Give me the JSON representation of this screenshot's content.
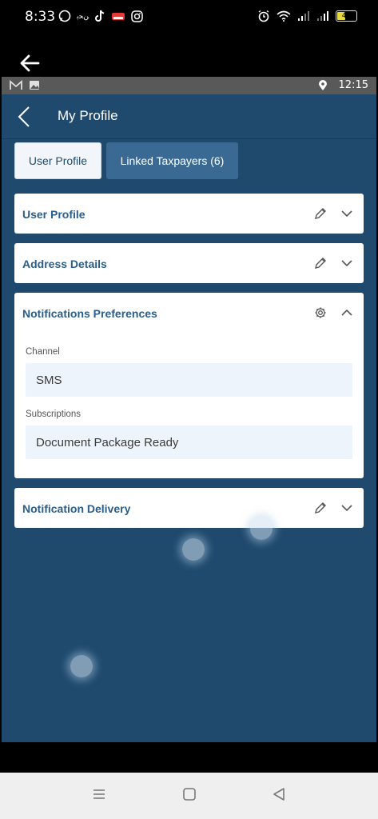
{
  "phone_status": {
    "time": "8:33",
    "app_icon_names": [
      "whatsapp-icon",
      "notification-text-icon",
      "tiktok-icon",
      "mail-app-icon",
      "instagram-icon"
    ],
    "right_icon_names": [
      "alarm-icon",
      "wifi-icon",
      "signal-icon",
      "signal-icon"
    ],
    "battery": "40"
  },
  "remote_status": {
    "time": "12:15"
  },
  "header": {
    "title": "My Profile"
  },
  "tabs": [
    {
      "label": "User Profile",
      "active": true
    },
    {
      "label": "Linked Taxpayers (6)",
      "active": false
    }
  ],
  "sections": {
    "user_profile": {
      "title": "User Profile"
    },
    "address_details": {
      "title": "Address Details"
    },
    "notifications_preferences": {
      "title": "Notifications Preferences",
      "channel_label": "Channel",
      "channel_value": "SMS",
      "subscriptions_label": "Subscriptions",
      "subscriptions_value": "Document Package Ready"
    },
    "notification_delivery": {
      "title": "Notification Delivery"
    }
  },
  "colors": {
    "app_background": "#1f4a6e",
    "section_title": "#2b5d8a",
    "tab_inactive": "#3a6a93",
    "field_background": "#eef4fb"
  }
}
